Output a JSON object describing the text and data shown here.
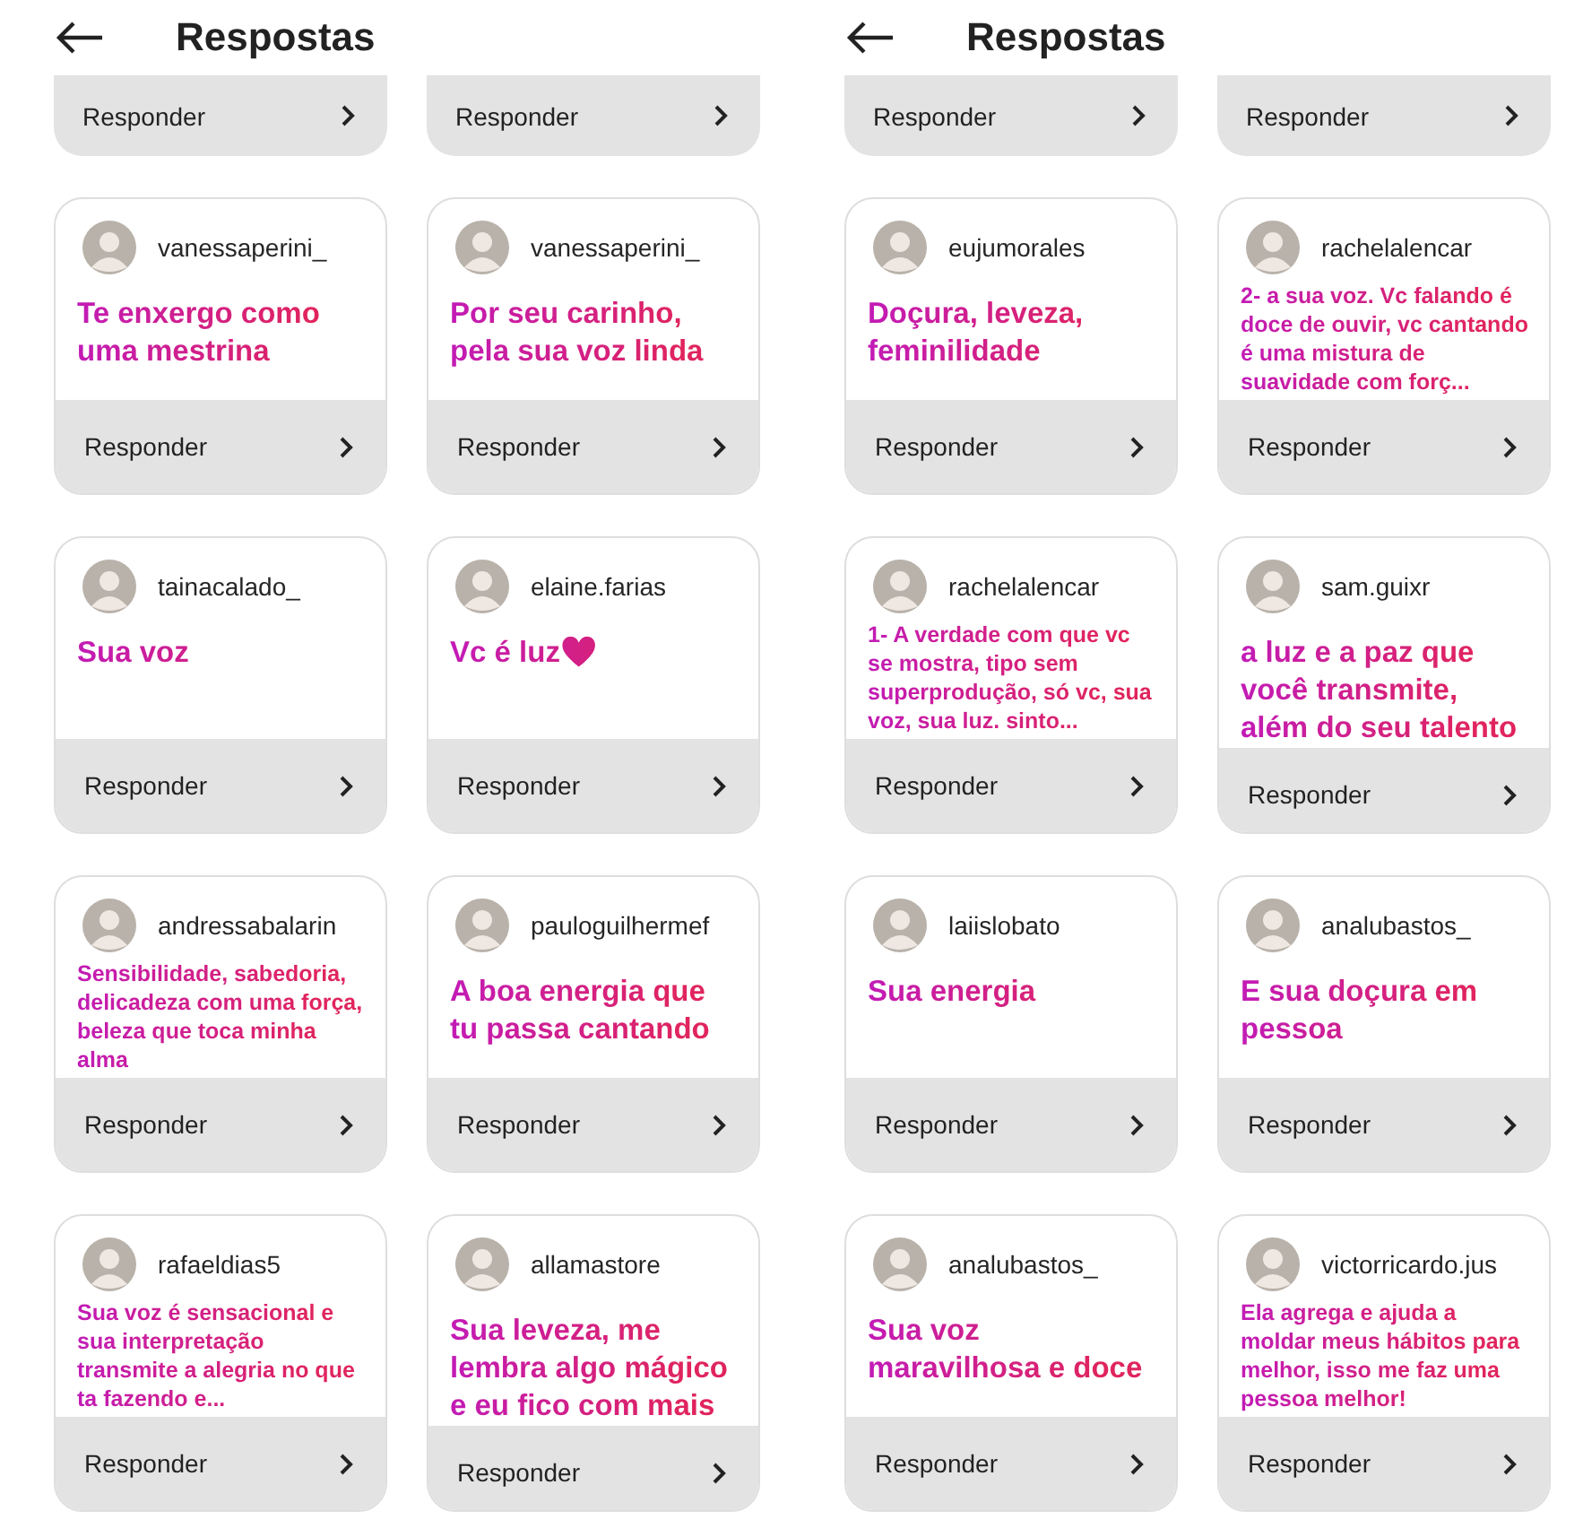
{
  "panels": [
    {
      "title": "Respostas",
      "top_bars": [
        {
          "reply": "Responder"
        },
        {
          "reply": "Responder"
        }
      ],
      "cards": [
        {
          "user": "vanessaperini_",
          "message": "Te enxergo como uma mestrina",
          "kind": "large",
          "reply": "Responder"
        },
        {
          "user": "vanessaperini_",
          "message": "Por seu carinho, pela sua voz linda",
          "kind": "large",
          "reply": "Responder"
        },
        {
          "user": "tainacalado_",
          "message": "Sua voz",
          "kind": "large",
          "reply": "Responder"
        },
        {
          "user": "elaine.farias",
          "message": "Vc é luz❤️",
          "kind": "large",
          "reply": "Responder"
        },
        {
          "user": "andressabalarin",
          "message": "Sensibilidade, sabedoria, delicadeza com uma força, beleza que toca minha alma",
          "kind": "small",
          "reply": "Responder"
        },
        {
          "user": "pauloguilhermef",
          "message": "A boa energia que tu passa cantando",
          "kind": "large",
          "reply": "Responder"
        },
        {
          "user": "rafaeldias5",
          "message": "Sua voz é sensacional e sua interpretação transmite a alegria no que ta fazendo e...",
          "kind": "small",
          "reply": "Responder"
        },
        {
          "user": "allamastore",
          "message": "Sua leveza, me lembra algo mágico e eu fico com mais",
          "kind": "large",
          "reply": "Responder"
        }
      ]
    },
    {
      "title": "Respostas",
      "top_bars": [
        {
          "reply": "Responder"
        },
        {
          "reply": "Responder"
        }
      ],
      "cards": [
        {
          "user": "eujumorales",
          "message": "Doçura, leveza, feminilidade",
          "kind": "large",
          "reply": "Responder"
        },
        {
          "user": "rachelalencar",
          "message": "2- a sua voz. Vc falando é doce de ouvir, vc cantando é uma mistura de suavidade com forç...",
          "kind": "small",
          "reply": "Responder"
        },
        {
          "user": "rachelalencar",
          "message": "1- A verdade com que vc se mostra, tipo sem superprodução, só vc, sua voz, sua luz. sinto...",
          "kind": "small",
          "reply": "Responder"
        },
        {
          "user": "sam.guixr",
          "message": "a luz e a paz que você transmite, além do seu talento",
          "kind": "large",
          "reply": "Responder"
        },
        {
          "user": "laiislobato",
          "message": "Sua energia",
          "kind": "large",
          "reply": "Responder"
        },
        {
          "user": "analubastos_",
          "message": "E sua doçura em pessoa",
          "kind": "large",
          "reply": "Responder"
        },
        {
          "user": "analubastos_",
          "message": "Sua voz maravilhosa e doce",
          "kind": "large",
          "reply": "Responder"
        },
        {
          "user": "victorricardo.jus",
          "message": "Ela agrega e ajuda a moldar meus hábitos para melhor, isso me faz uma pessoa melhor!",
          "kind": "small",
          "reply": "Responder"
        }
      ]
    }
  ]
}
